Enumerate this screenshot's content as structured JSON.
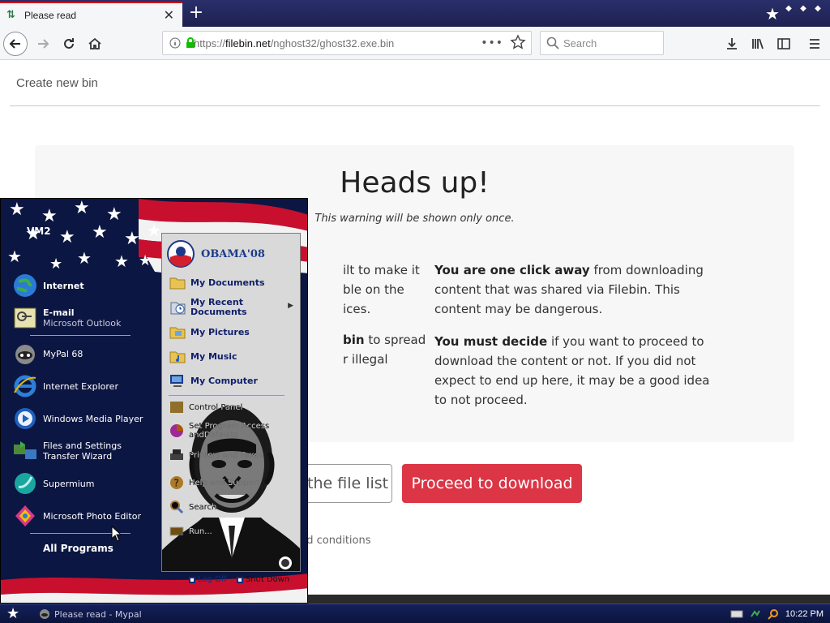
{
  "browser": {
    "tab_title": "Please read",
    "url_prefix": "https://",
    "url_host": "filebin.net",
    "url_path": "/nghost32/ghost32.exe.bin",
    "search_placeholder": "Search"
  },
  "page": {
    "create_new_bin": "Create new bin",
    "heading": "Heads up!",
    "warning_once": "This warning will be shown only once.",
    "left_p1": "ilt to make it",
    "left_p1_l2": "ble on the",
    "left_p1_l3": "ices.",
    "left_p2_bold": "bin",
    "left_p2_rest": " to spread",
    "left_p2_l2": "r illegal",
    "right_p1_bold": "You are one click away",
    "right_p1_rest": " from downloading content that was shared via Filebin. This content may be dangerous.",
    "right_p2_bold": "You must decide",
    "right_p2_rest": " if you want to proceed to download the content or not. If you did not expect to end up here, it may be a good idea to not proceed.",
    "filelist_button": "the file list",
    "proceed_button": "Proceed to download",
    "terms_text": "nd conditions"
  },
  "start_menu": {
    "user": "VM2",
    "left_items": [
      {
        "label": "Internet",
        "sub": "",
        "icon": "globe-icon"
      },
      {
        "label": "E-mail",
        "sub": "Microsoft Outlook",
        "icon": "email-icon"
      },
      {
        "label": "MyPal 68",
        "sub": "",
        "icon": "mypal-icon"
      },
      {
        "label": "Internet Explorer",
        "sub": "",
        "icon": "ie-icon"
      },
      {
        "label": "Windows Media Player",
        "sub": "",
        "icon": "media-player-icon"
      },
      {
        "label": "Files and Settings",
        "sub": "Transfer Wizard",
        "icon": "transfer-wizard-icon"
      },
      {
        "label": "Supermium",
        "sub": "",
        "icon": "supermium-icon"
      },
      {
        "label": "Microsoft Photo Editor",
        "sub": "",
        "icon": "photo-editor-icon"
      }
    ],
    "all_programs": "All Programs",
    "logo_text": "OBAMA'08",
    "right_items": [
      {
        "label": "My Documents",
        "label2": ""
      },
      {
        "label": "My Recent",
        "label2": "Documents"
      },
      {
        "label": "My Pictures",
        "label2": ""
      },
      {
        "label": "My Music",
        "label2": ""
      },
      {
        "label": "My Computer",
        "label2": ""
      }
    ],
    "right_items_lower": [
      {
        "label": "Control Panel",
        "label2": ""
      },
      {
        "label": "Set Program Access and",
        "label2": "Defaults"
      },
      {
        "label": "Printers and Faxes",
        "label2": ""
      },
      {
        "label": "Help and Support",
        "label2": ""
      },
      {
        "label": "Search",
        "label2": ""
      },
      {
        "label": "Run...",
        "label2": ""
      }
    ],
    "log_off": "Log Off",
    "shut_down": "Shut Down"
  },
  "taskbar": {
    "task_label": "Please read - Mypal",
    "clock": "10:22 PM"
  },
  "colors": {
    "proceed": "#dc3545",
    "accent_tab": "#d0021b",
    "taskbar": "#15205a"
  }
}
